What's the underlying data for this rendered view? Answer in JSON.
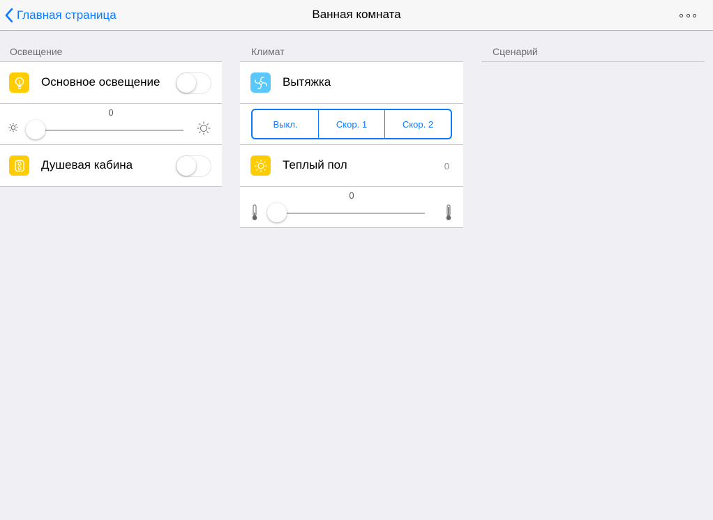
{
  "navbar": {
    "back_label": "Главная страница",
    "title": "Ванная комната"
  },
  "lighting": {
    "header": "Освещение",
    "main_light": {
      "label": "Основное освещение",
      "on": false
    },
    "dimmer": {
      "value": "0"
    },
    "shower": {
      "label": "Душевая кабина",
      "on": false
    }
  },
  "climate": {
    "header": "Климат",
    "exhaust": {
      "label": "Вытяжка"
    },
    "speed": {
      "options": [
        "Выкл.",
        "Скор. 1",
        "Скор. 2"
      ]
    },
    "floor": {
      "label": "Теплый пол",
      "value": "0"
    },
    "floor_slider": {
      "value": "0"
    }
  },
  "scenario": {
    "header": "Сценарий"
  },
  "colors": {
    "accent": "#0a7aff",
    "icon_yellow": "#ffcc00",
    "icon_blue": "#5ac8fa",
    "background": "#efeff4"
  }
}
